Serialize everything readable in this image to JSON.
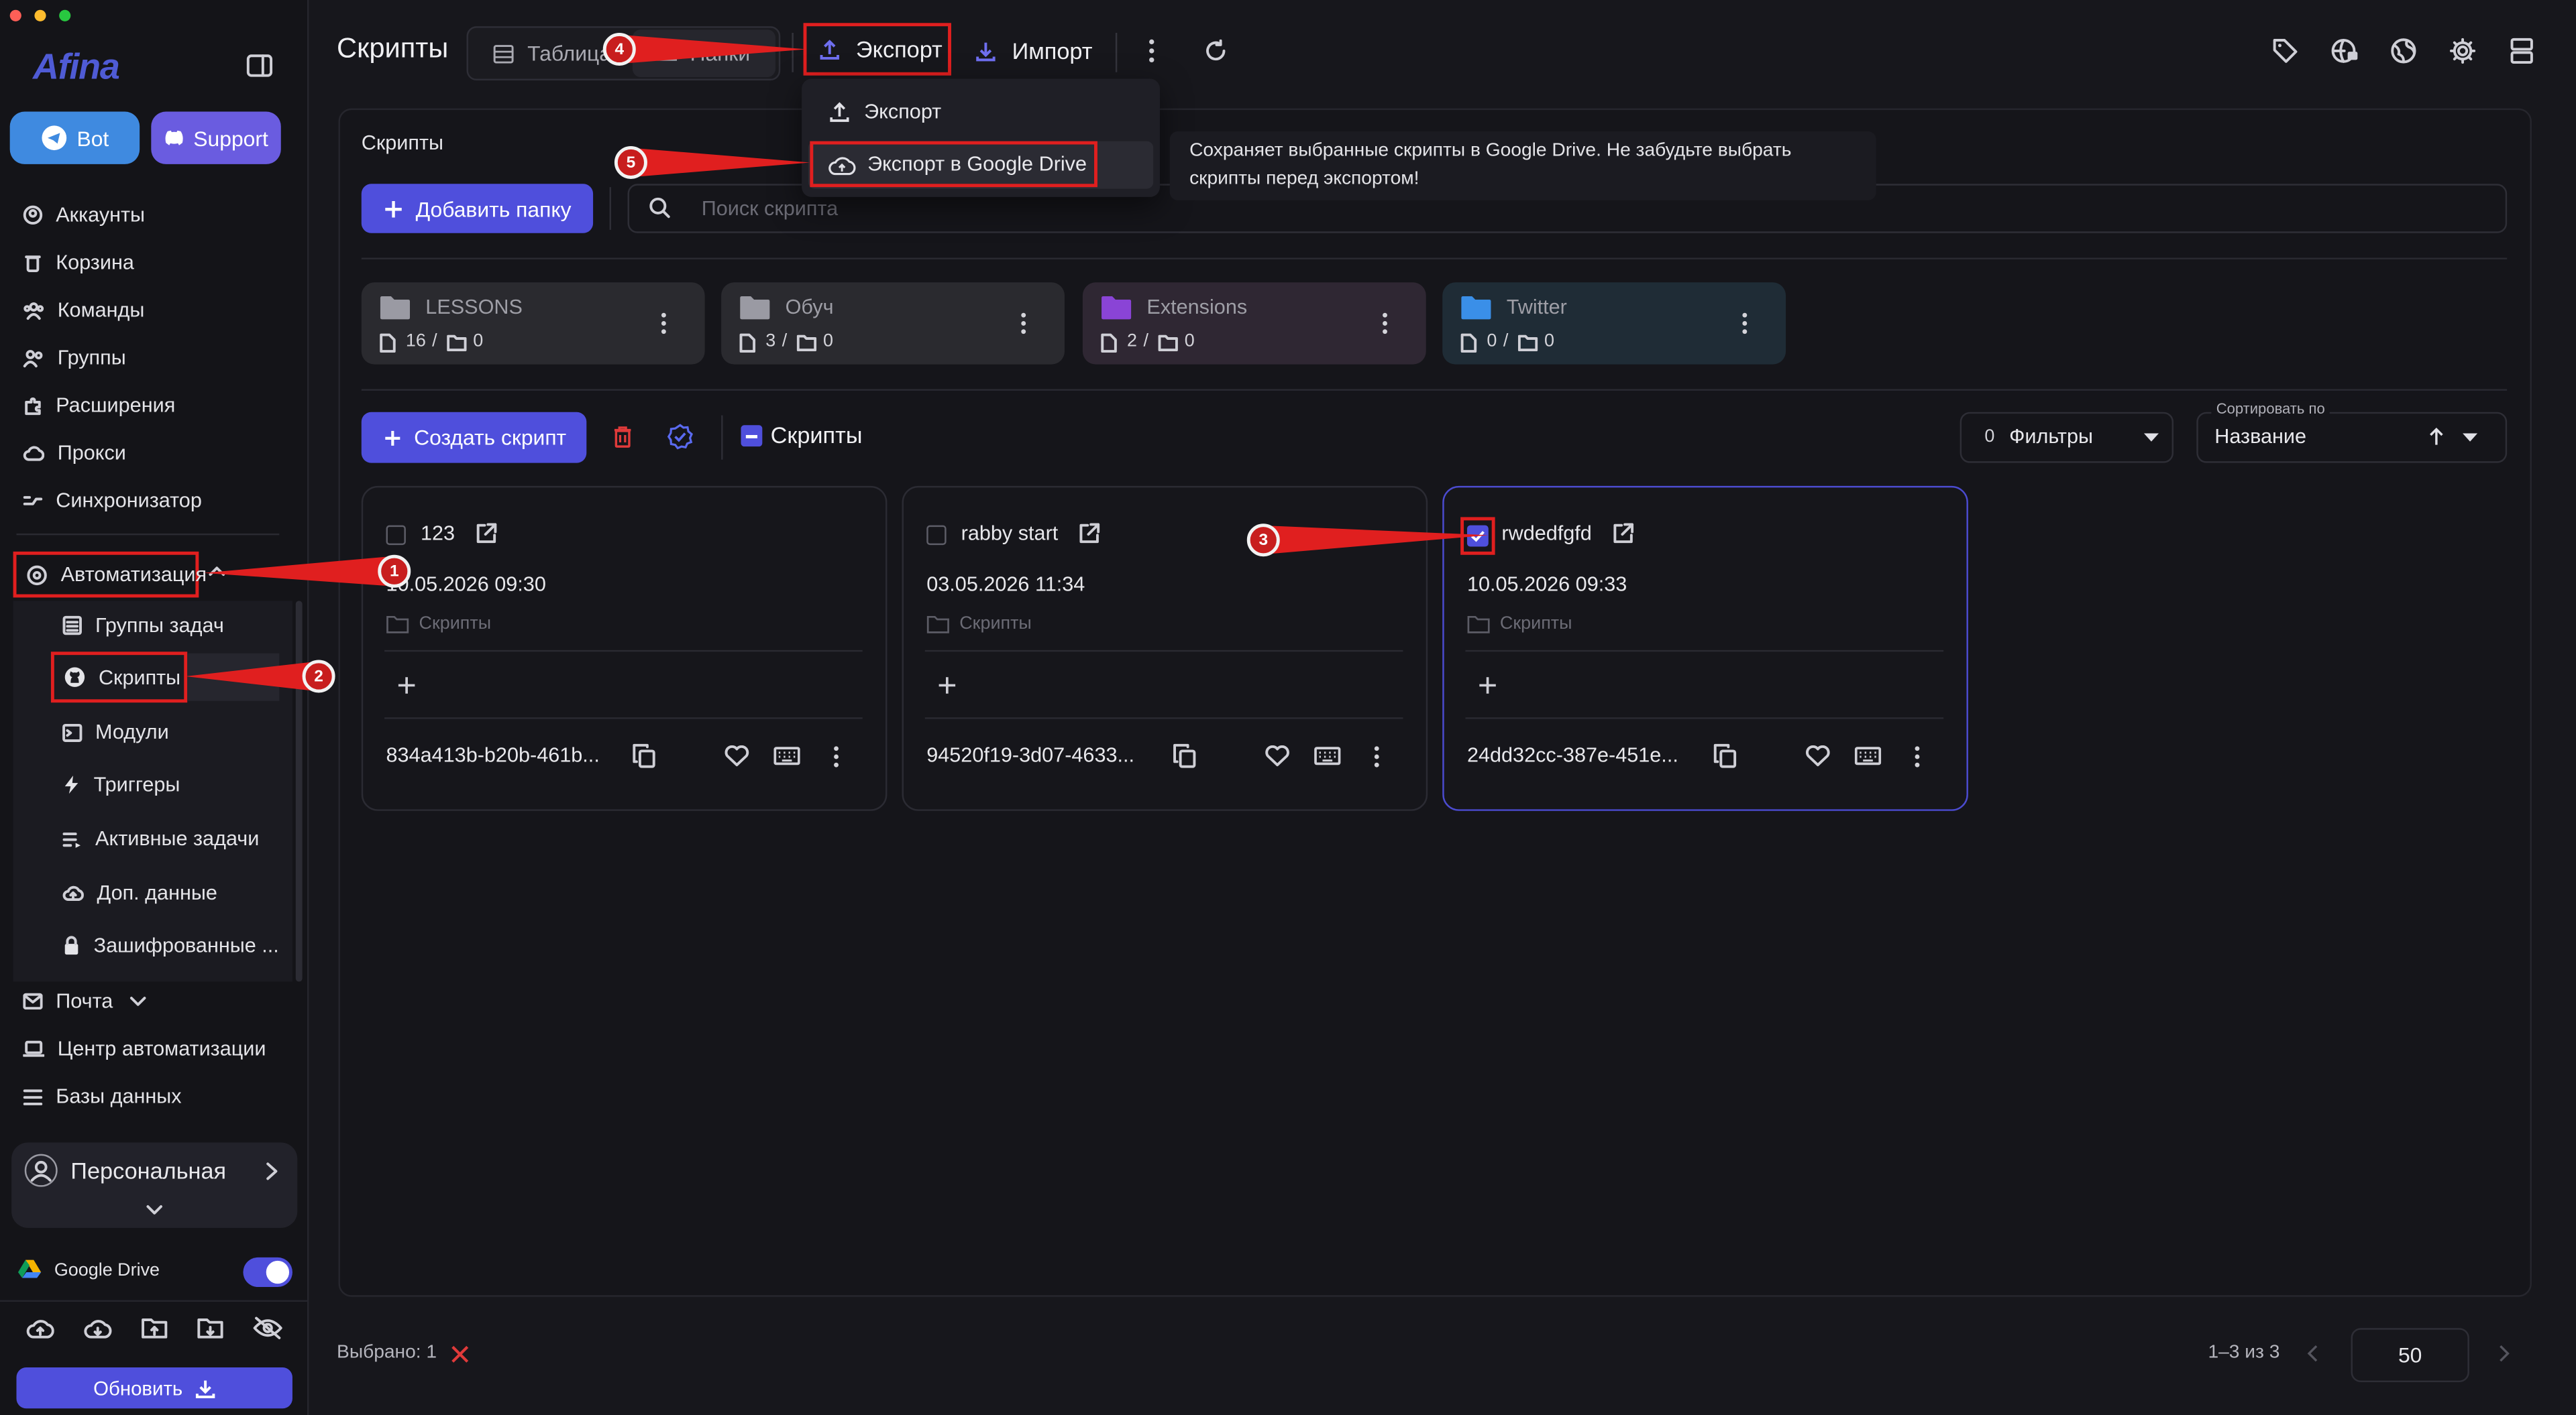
{
  "app": {
    "logo": "Afina",
    "bot_label": "Bot",
    "support_label": "Support"
  },
  "sidebar": {
    "items": [
      {
        "label": "Аккаунты"
      },
      {
        "label": "Корзина"
      },
      {
        "label": "Команды"
      },
      {
        "label": "Группы"
      },
      {
        "label": "Расширения"
      },
      {
        "label": "Прокси"
      },
      {
        "label": "Синхронизатор"
      }
    ],
    "automation": {
      "label": "Автоматизация",
      "children": [
        {
          "label": "Группы задач"
        },
        {
          "label": "Скрипты"
        },
        {
          "label": "Модули"
        },
        {
          "label": "Триггеры"
        },
        {
          "label": "Активные задачи"
        },
        {
          "label": "Доп. данные"
        },
        {
          "label": "Зашифрованные ..."
        }
      ]
    },
    "mail_label": "Почта",
    "automation_center_label": "Центр автоматизации",
    "databases_label": "Базы данных",
    "workspace_label": "Персональная",
    "google_drive_label": "Google Drive",
    "google_drive_enabled": true,
    "update_label": "Обновить"
  },
  "header": {
    "title": "Скрипты",
    "view_table_label": "Таблица",
    "view_folders_label": "Папки",
    "export_label": "Экспорт",
    "import_label": "Импорт"
  },
  "export_menu": {
    "items": [
      {
        "label": "Экспорт"
      },
      {
        "label": "Экспорт в Google Drive"
      }
    ],
    "tooltip": "Сохраняет выбранные скрипты в Google Drive. Не забудьте выбрать скрипты перед экспортом!"
  },
  "main": {
    "section_title": "Скрипты",
    "add_folder_label": "Добавить папку",
    "search_placeholder": "Поиск скрипта",
    "folders": [
      {
        "name": "LESSONS",
        "files": "16",
        "subfolders": "0",
        "color": "#9a9aa3",
        "bg": "#2a2a2f"
      },
      {
        "name": "Обуч",
        "files": "3",
        "subfolders": "0",
        "color": "#9a9aa3",
        "bg": "#2a2a2f"
      },
      {
        "name": "Extensions",
        "files": "2",
        "subfolders": "0",
        "color": "#8a44d6",
        "bg": "#2f2733"
      },
      {
        "name": "Twitter",
        "files": "0",
        "subfolders": "0",
        "color": "#3a8fe8",
        "bg": "#1f2c36"
      }
    ],
    "create_script_label": "Создать скрипт",
    "scripts_toggle_label": "Скрипты",
    "filters_count": "0",
    "filters_label": "Фильтры",
    "sort_caption": "Сортировать по",
    "sort_value": "Название"
  },
  "scripts": [
    {
      "name": "123",
      "date": "10.05.2026 09:30",
      "folder": "Скрипты",
      "id": "834a413b-b20b-461b...",
      "checked": false
    },
    {
      "name": "rabby start",
      "date": "03.05.2026 11:34",
      "folder": "Скрипты",
      "id": "94520f19-3d07-4633...",
      "checked": false
    },
    {
      "name": "rwdedfgfd",
      "date": "10.05.2026 09:33",
      "folder": "Скрипты",
      "id": "24dd32cc-387e-451e...",
      "checked": true
    }
  ],
  "footer": {
    "selected": "Выбрано: 1",
    "range": "1–3 из 3",
    "page_size": "50"
  },
  "annotations": [
    "1",
    "2",
    "3",
    "4",
    "5"
  ],
  "colors": {
    "accent": "#4f4fdc",
    "annotation": "#e01f1f",
    "support": "#6a5ce0",
    "bot": "#3f8ae0"
  }
}
